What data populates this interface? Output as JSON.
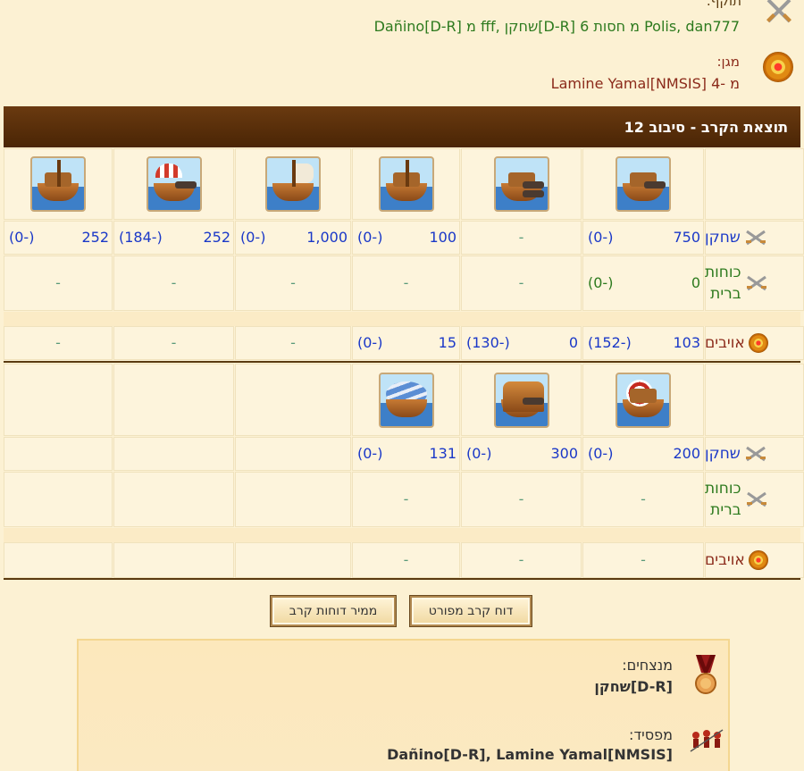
{
  "participants": {
    "attacker_label": "תוקף:",
    "attacker_value": "Dañino[D-R] מ fff, שחקן[D-R] מ חסות 6 Polis, dan777",
    "defender_label": "מגן:",
    "defender_value": "Lamine Yamal[NMSIS] מ -4"
  },
  "round": {
    "title": "תוצאת הקרב - סיבוב 12"
  },
  "row_labels": {
    "player": "שחקן",
    "allied_forces_line1": "כוחות",
    "allied_forces_line2": "ברית",
    "enemies": "אויבים"
  },
  "section1": {
    "units": [
      "catapult-ship",
      "cannon-ship",
      "crane-ship",
      "sail-ship",
      "mortar-ship",
      "paddle-ship"
    ],
    "player": [
      {
        "count": "750",
        "loss": "(0-)"
      },
      {
        "count": "-",
        "loss": ""
      },
      {
        "count": "100",
        "loss": "(0-)"
      },
      {
        "count": "1,000",
        "loss": "(0-)"
      },
      {
        "count": "252",
        "loss": "(184-)"
      },
      {
        "count": "252",
        "loss": "(0-)"
      }
    ],
    "allied": [
      {
        "count": "0",
        "loss": "(0-)"
      },
      {
        "count": "-",
        "loss": ""
      },
      {
        "count": "-",
        "loss": ""
      },
      {
        "count": "-",
        "loss": ""
      },
      {
        "count": "-",
        "loss": ""
      },
      {
        "count": "-",
        "loss": ""
      }
    ],
    "enemies": [
      {
        "count": "103",
        "loss": "(152-)"
      },
      {
        "count": "0",
        "loss": "(130-)"
      },
      {
        "count": "15",
        "loss": "(0-)"
      },
      {
        "count": "-",
        "loss": ""
      },
      {
        "count": "-",
        "loss": ""
      },
      {
        "count": "-",
        "loss": ""
      }
    ]
  },
  "section2": {
    "units": [
      "target-ship",
      "gyro-ship",
      "balloon-ship"
    ],
    "player": [
      {
        "count": "200",
        "loss": "(0-)"
      },
      {
        "count": "300",
        "loss": "(0-)"
      },
      {
        "count": "131",
        "loss": "(0-)"
      }
    ],
    "allied": [
      {
        "count": "-",
        "loss": ""
      },
      {
        "count": "-",
        "loss": ""
      },
      {
        "count": "-",
        "loss": ""
      }
    ],
    "enemies": [
      {
        "count": "-",
        "loss": ""
      },
      {
        "count": "-",
        "loss": ""
      },
      {
        "count": "-",
        "loss": ""
      }
    ]
  },
  "buttons": {
    "detailed_report": "דוח קרב מפורט",
    "report_sorter": "ממיר דוחות קרב"
  },
  "result": {
    "winners_label": "מנצחים:",
    "winners_value": "שחקן[D-R]",
    "losers_label": "מפסיד:",
    "losers_value": "Dañino[D-R], Lamine Yamal[NMSIS]"
  },
  "colors": {
    "background": "#fcf1d3",
    "band": "#4a2505",
    "player_blue": "#1a38c8",
    "allied_green": "#2d7a1e",
    "enemy_red": "#8b2a1a"
  }
}
